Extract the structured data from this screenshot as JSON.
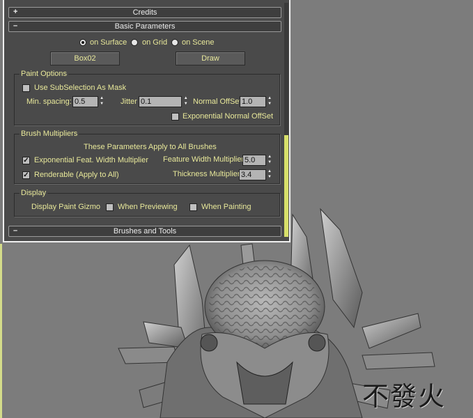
{
  "rollouts": {
    "credits": {
      "sign": "+",
      "title": "Credits"
    },
    "basic": {
      "sign": "–",
      "title": "Basic Parameters"
    },
    "brushes": {
      "sign": "–",
      "title": "Brushes and Tools"
    }
  },
  "surface_mode": {
    "options": [
      "on Surface",
      "on Grid",
      "on Scene"
    ],
    "selected": "on Surface"
  },
  "buttons": {
    "object": "Box02",
    "draw": "Draw"
  },
  "paint_options": {
    "title": "Paint Options",
    "use_subselection": {
      "label": "Use SubSelection As Mask",
      "checked": false
    },
    "min_spacing": {
      "label": "Min. spacing:",
      "value": "0.5"
    },
    "jitter": {
      "label": "Jitter",
      "value": "0.1"
    },
    "normal_offset": {
      "label": "Normal OffSet",
      "value": "1.0"
    },
    "exp_normal_offset": {
      "label": "Exponential Normal OffSet",
      "checked": false
    }
  },
  "brush_multipliers": {
    "title": "Brush Multipliers",
    "note": "These Parameters Apply to All Brushes",
    "exp_feat_width": {
      "label": "Exponential Feat. Width Multiplier",
      "checked": true
    },
    "renderable": {
      "label": "Renderable (Apply to All)",
      "checked": true
    },
    "feature_width": {
      "label": "Feature Width Multiplier",
      "value": "5.0"
    },
    "thickness": {
      "label": "Thickness Multiplier",
      "value": "3.4"
    }
  },
  "display": {
    "title": "Display",
    "gizmo_label": "Display Paint Gizmo",
    "when_previewing": {
      "label": "When Previewing",
      "checked": false
    },
    "when_painting": {
      "label": "When Painting",
      "checked": false
    }
  },
  "watermark": "不發火",
  "colors": {
    "label": "#e8e89a",
    "panel": "#4a4a4a",
    "accent": "#d8e06a",
    "viewport": "#7c7c7c"
  },
  "icons": {
    "radio": "radio-button",
    "check": "checkbox",
    "spinner": "spinner-arrows"
  }
}
